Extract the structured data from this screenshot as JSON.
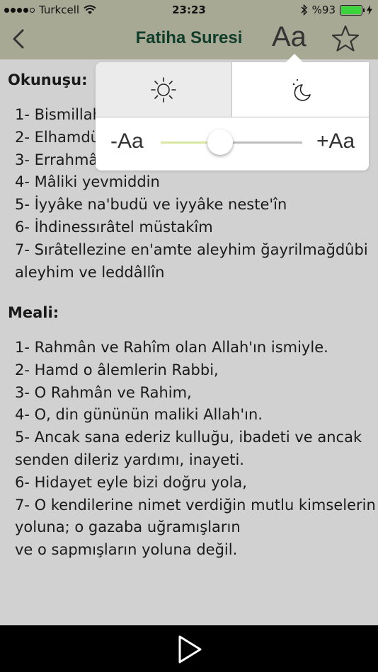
{
  "status": {
    "carrier": "Turkcell",
    "time": "23:23",
    "battery": "%93",
    "battery_level": 0.93
  },
  "nav": {
    "title": "Fatiha Suresi",
    "font_button": "Aa"
  },
  "content": {
    "reading_heading": "Okunuşu:",
    "reading_lines": [
      "1- Bismillah",
      "2- Elhamdü",
      "3- Errahmâ",
      "4- Mâliki yevmiddin",
      "5- İyyâke na'budü ve iyyâke neste'în",
      "6- İhdinessırâtel müstakîm",
      "7- Sırâtellezine en'amte aleyhim ğayrilmağdûbi",
      "aleyhim ve leddâllîn"
    ],
    "meaning_heading": "Meali:",
    "meaning_lines": [
      "1- Rahmân ve Rahîm olan Allah'ın ismiyle.",
      "2- Hamd o âlemlerin Rabbi,",
      "3- O Rahmân ve Rahim,",
      "4- O, din gününün maliki Allah'ın.",
      "5- Ancak sana ederiz kulluğu, ibadeti ve ancak",
      "senden dileriz yardımı, inayeti.",
      "6- Hidayet eyle bizi doğru yola,",
      "7- O kendilerine nimet verdiğin mutlu kimselerin",
      "yoluna; o gazaba uğramışların",
      "ve o sapmışların yoluna değil."
    ]
  },
  "popover": {
    "decrease_label": "-Aa",
    "increase_label": "+Aa",
    "font_size_level": 0.42,
    "selected_mode": "day"
  },
  "icons": {
    "back": "chevron-left-icon",
    "favorite": "star-outline-icon",
    "day": "sun-icon",
    "night": "moon-stars-icon",
    "play": "play-icon"
  },
  "colors": {
    "bar": "#a7a994",
    "title": "#0f3d2a",
    "background": "#d1d1d1",
    "slider_fill": "#d8e6a0",
    "battery": "#3bd43b"
  }
}
